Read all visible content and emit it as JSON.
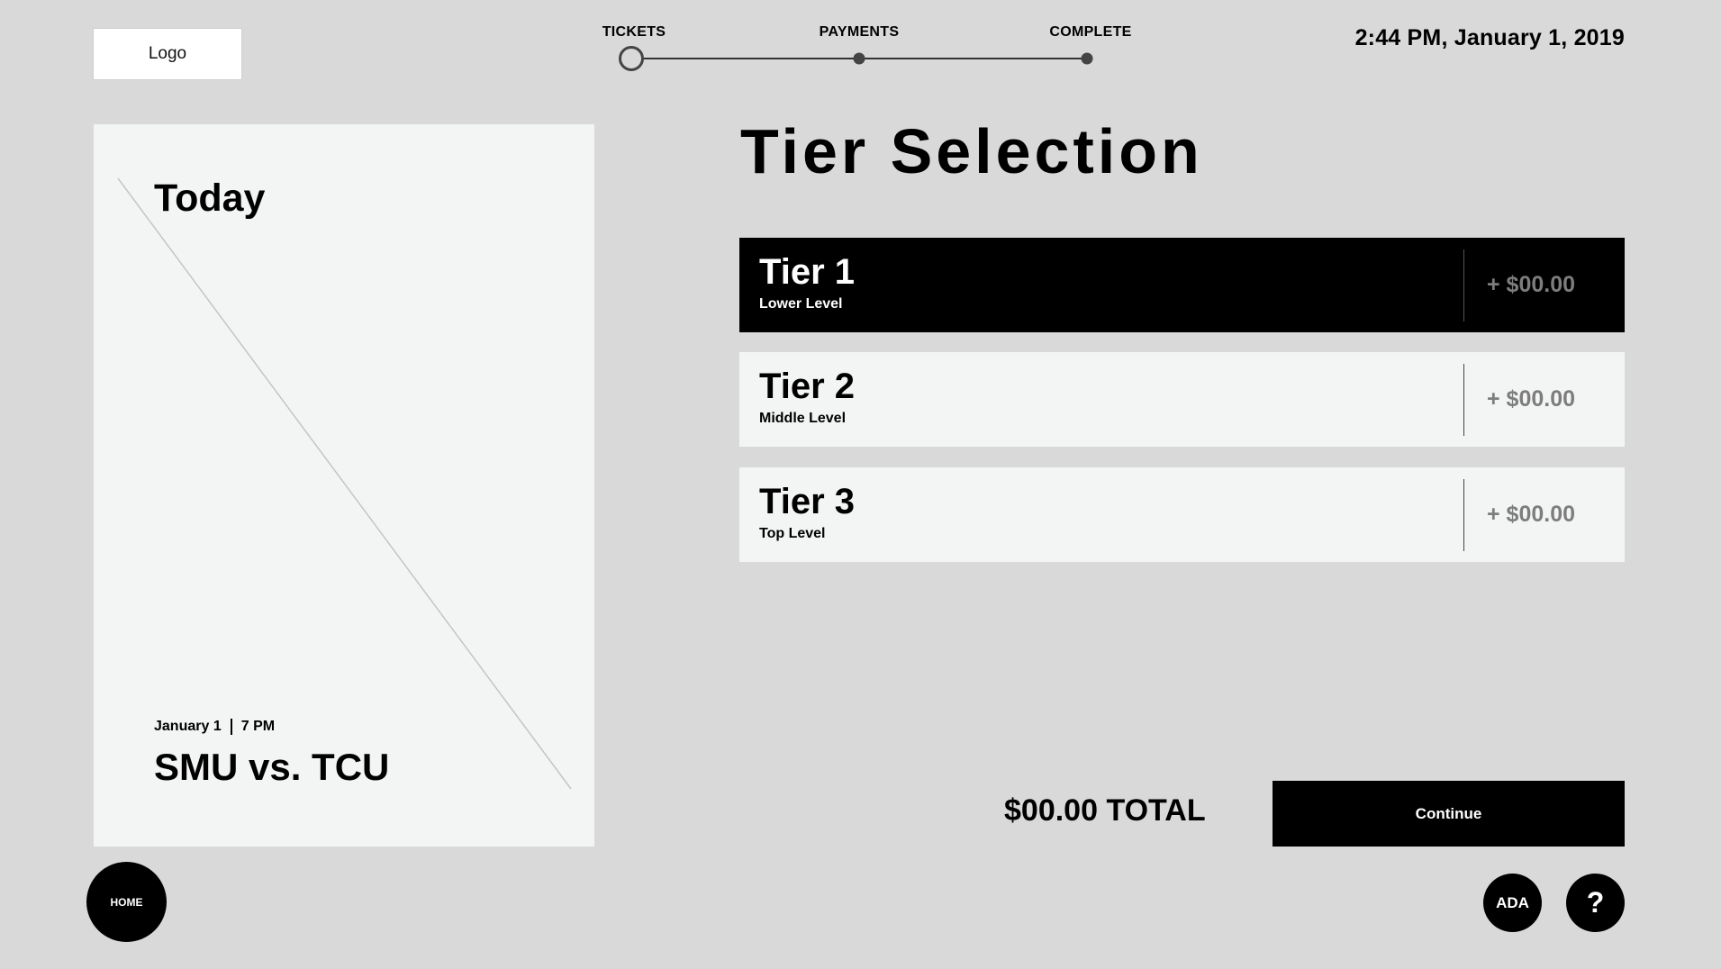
{
  "header": {
    "logo_label": "Logo",
    "datetime": "2:44 PM, January 1, 2019"
  },
  "progress": {
    "steps": [
      {
        "label": "TICKETS",
        "state": "current"
      },
      {
        "label": "PAYMENTS",
        "state": "upcoming"
      },
      {
        "label": "COMPLETE",
        "state": "upcoming"
      }
    ]
  },
  "event": {
    "day_label": "Today",
    "date": "January 1",
    "time": "7 PM",
    "title": "SMU vs. TCU"
  },
  "main": {
    "heading": "Tier Selection",
    "tiers": [
      {
        "name": "Tier 1",
        "level": "Lower Level",
        "price": "+ $00.00",
        "selected": true
      },
      {
        "name": "Tier 2",
        "level": "Middle Level",
        "price": "+ $00.00",
        "selected": false
      },
      {
        "name": "Tier 3",
        "level": "Top Level",
        "price": "+ $00.00",
        "selected": false
      }
    ],
    "total": "$00.00 TOTAL",
    "continue_label": "Continue"
  },
  "footer": {
    "home_label": "HOME",
    "ada_label": "ADA",
    "help_label": "?"
  },
  "colors": {
    "background": "#d9d9d9",
    "card": "#f3f5f4",
    "accent": "#000000",
    "price_text": "#7d7d7d"
  }
}
